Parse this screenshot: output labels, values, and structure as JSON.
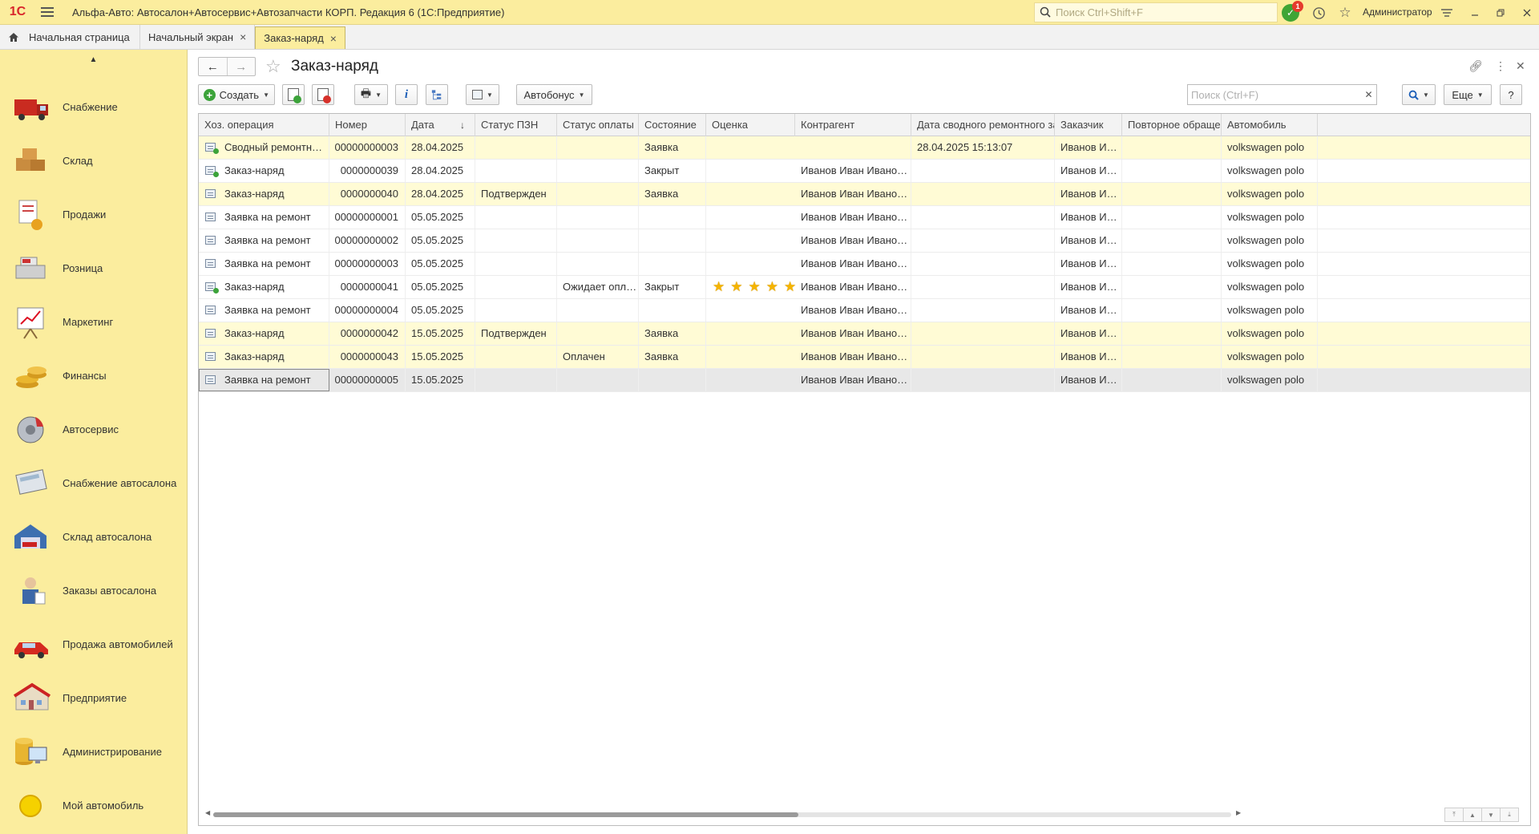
{
  "app": {
    "logo": "1С",
    "title": "Альфа-Авто: Автосалон+Автосервис+Автозапчасти КОРП. Редакция 6  (1С:Предприятие)",
    "search_placeholder": "Поиск Ctrl+Shift+F",
    "notifications_count": "1",
    "user": "Администратор"
  },
  "tabs": [
    {
      "label": "Начальная страница"
    },
    {
      "label": "Начальный экран"
    },
    {
      "label": "Заказ-наряд"
    }
  ],
  "sidebar": {
    "items": [
      {
        "label": "Снабжение",
        "icon": "truck-icon"
      },
      {
        "label": "Склад",
        "icon": "boxes-icon"
      },
      {
        "label": "Продажи",
        "icon": "sales-doc-icon"
      },
      {
        "label": "Розница",
        "icon": "cash-register-icon"
      },
      {
        "label": "Маркетинг",
        "icon": "chart-board-icon"
      },
      {
        "label": "Финансы",
        "icon": "coins-icon"
      },
      {
        "label": "Автосервис",
        "icon": "disc-brake-icon"
      },
      {
        "label": "Снабжение автосалона",
        "icon": "calculator-icon"
      },
      {
        "label": "Склад автосалона",
        "icon": "garage-icon"
      },
      {
        "label": "Заказы автосалона",
        "icon": "manager-icon"
      },
      {
        "label": "Продажа автомобилей",
        "icon": "red-car-icon"
      },
      {
        "label": "Предприятие",
        "icon": "building-icon"
      },
      {
        "label": "Администрирование",
        "icon": "admin-computer-icon"
      },
      {
        "label": "Мой автомобиль",
        "icon": "yellow-circle-icon"
      }
    ]
  },
  "form": {
    "title": "Заказ-наряд",
    "create_label": "Создать",
    "autobonus_label": "Автобонус",
    "search_placeholder": "Поиск (Ctrl+F)",
    "more_label": "Еще",
    "help_label": "?"
  },
  "table": {
    "columns": [
      "Хоз. операция",
      "Номер",
      "Дата",
      "Статус ПЗН",
      "Статус оплаты",
      "Состояние",
      "Оценка",
      "Контрагент",
      "Дата сводного ремонтного заказа",
      "Заказчик",
      "Повторное обращение",
      "Автомобиль"
    ],
    "rows": [
      {
        "op": "Сводный ремонтный заказ",
        "num": "00000000003",
        "date": "28.04.2025",
        "pzn": "",
        "pay": "",
        "state": "Заявка",
        "rating": 0,
        "contractor": "",
        "summary_date": "28.04.2025 15:13:07",
        "customer": "Иванов Ива...",
        "repeat": "",
        "car": "volkswagen polo",
        "style": "yellow",
        "icon": "ok"
      },
      {
        "op": "Заказ-наряд",
        "num": "0000000039",
        "date": "28.04.2025",
        "pzn": "",
        "pay": "",
        "state": "Закрыт",
        "rating": 0,
        "contractor": "Иванов Иван Иванович",
        "summary_date": "",
        "customer": "Иванов Ива...",
        "repeat": "",
        "car": "volkswagen polo",
        "style": "white",
        "icon": "ok"
      },
      {
        "op": "Заказ-наряд",
        "num": "0000000040",
        "date": "28.04.2025",
        "pzn": "Подтвержден",
        "pay": "",
        "state": "Заявка",
        "rating": 0,
        "contractor": "Иванов Иван Иванович",
        "summary_date": "",
        "customer": "Иванов Ива...",
        "repeat": "",
        "car": "volkswagen polo",
        "style": "yellow",
        "icon": "doc"
      },
      {
        "op": "Заявка на ремонт",
        "num": "00000000001",
        "date": "05.05.2025",
        "pzn": "",
        "pay": "",
        "state": "",
        "rating": 0,
        "contractor": "Иванов Иван Иванович",
        "summary_date": "",
        "customer": "Иванов Ива...",
        "repeat": "",
        "car": "volkswagen polo",
        "style": "white",
        "icon": "doc"
      },
      {
        "op": "Заявка на ремонт",
        "num": "00000000002",
        "date": "05.05.2025",
        "pzn": "",
        "pay": "",
        "state": "",
        "rating": 0,
        "contractor": "Иванов Иван Иванович",
        "summary_date": "",
        "customer": "Иванов Ива...",
        "repeat": "",
        "car": "volkswagen polo",
        "style": "white",
        "icon": "doc"
      },
      {
        "op": "Заявка на ремонт",
        "num": "00000000003",
        "date": "05.05.2025",
        "pzn": "",
        "pay": "",
        "state": "",
        "rating": 0,
        "contractor": "Иванов Иван Иванович",
        "summary_date": "",
        "customer": "Иванов Ива...",
        "repeat": "",
        "car": "volkswagen polo",
        "style": "white",
        "icon": "doc"
      },
      {
        "op": "Заказ-наряд",
        "num": "0000000041",
        "date": "05.05.2025",
        "pzn": "",
        "pay": "Ожидает оплату",
        "state": "Закрыт",
        "rating": 5,
        "contractor": "Иванов Иван Иванович",
        "summary_date": "",
        "customer": "Иванов Ива...",
        "repeat": "",
        "car": "volkswagen polo",
        "style": "white",
        "icon": "ok"
      },
      {
        "op": "Заявка на ремонт",
        "num": "00000000004",
        "date": "05.05.2025",
        "pzn": "",
        "pay": "",
        "state": "",
        "rating": 0,
        "contractor": "Иванов Иван Иванович",
        "summary_date": "",
        "customer": "Иванов Ива...",
        "repeat": "",
        "car": "volkswagen polo",
        "style": "white",
        "icon": "doc"
      },
      {
        "op": "Заказ-наряд",
        "num": "0000000042",
        "date": "15.05.2025",
        "pzn": "Подтвержден",
        "pay": "",
        "state": "Заявка",
        "rating": 0,
        "contractor": "Иванов Иван Иванович",
        "summary_date": "",
        "customer": "Иванов Ива...",
        "repeat": "",
        "car": "volkswagen polo",
        "style": "yellow",
        "icon": "doc"
      },
      {
        "op": "Заказ-наряд",
        "num": "0000000043",
        "date": "15.05.2025",
        "pzn": "",
        "pay": "Оплачен",
        "state": "Заявка",
        "rating": 0,
        "contractor": "Иванов Иван Иванович",
        "summary_date": "",
        "customer": "Иванов Ива...",
        "repeat": "",
        "car": "volkswagen polo",
        "style": "yellow",
        "icon": "doc"
      },
      {
        "op": "Заявка на ремонт",
        "num": "00000000005",
        "date": "15.05.2025",
        "pzn": "",
        "pay": "",
        "state": "",
        "rating": 0,
        "contractor": "Иванов Иван Иванович",
        "summary_date": "",
        "customer": "Иванов Ива...",
        "repeat": "",
        "car": "volkswagen polo",
        "style": "sel",
        "icon": "doc"
      }
    ]
  }
}
